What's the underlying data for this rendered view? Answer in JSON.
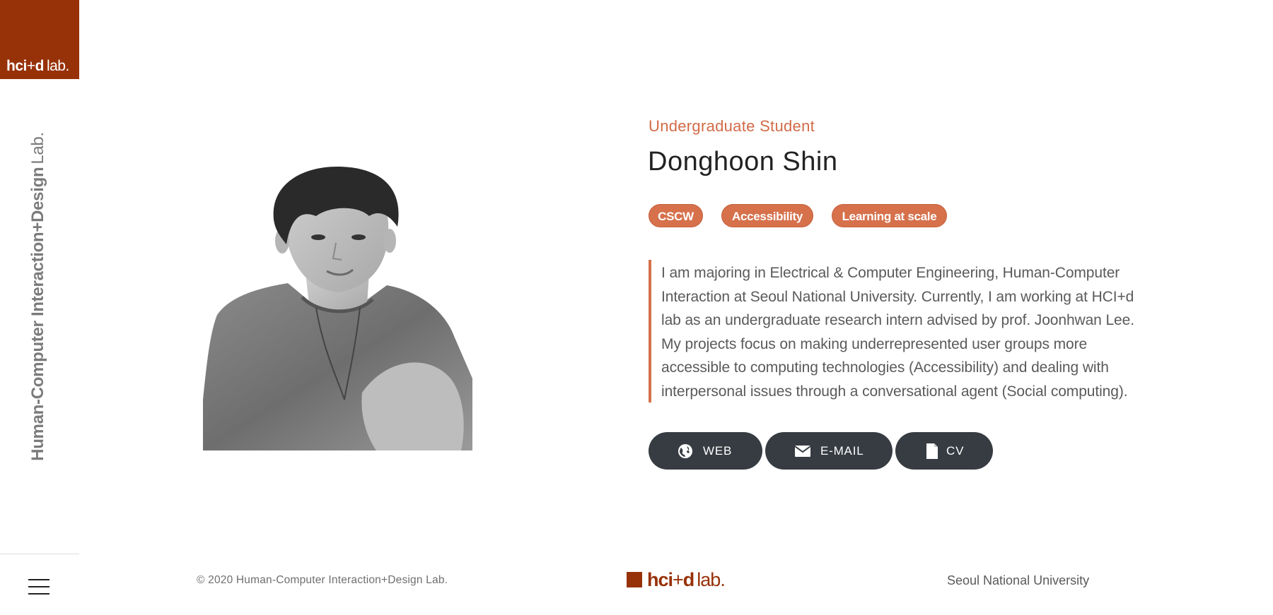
{
  "brand": {
    "logo_bold": "hci",
    "logo_plus": "+",
    "logo_d": "d",
    "logo_lab": "lab.",
    "accent_color": "#973108"
  },
  "sidebar": {
    "vertical_title_bold": "Human-Computer Interaction+Design",
    "vertical_title_lab": "Lab.",
    "menu_icon": "hamburger-menu-icon"
  },
  "profile": {
    "role": "Undergraduate Student",
    "name": "Donghoon Shin",
    "tags": [
      "CSCW",
      "Accessibility",
      "Learning at scale"
    ],
    "bio": "I am majoring in Electrical & Computer Engineering, Human-Computer Interaction at Seoul National University. Currently, I am working at HCI+d lab as an undergraduate research intern advised by prof. Joonhwan Lee. My projects focus on making underrepresented user groups more accessible to computing technologies (Accessibility) and dealing with interpersonal issues through a conversational agent (Social computing).",
    "tag_color": "#d6714c"
  },
  "links": [
    {
      "label": "WEB",
      "icon": "globe-icon"
    },
    {
      "label": "E-MAIL",
      "icon": "envelope-icon"
    },
    {
      "label": "CV",
      "icon": "document-icon"
    }
  ],
  "footer": {
    "copyright": "© 2020 Human-Computer Interaction+Design Lab.",
    "university": "Seoul National University"
  }
}
